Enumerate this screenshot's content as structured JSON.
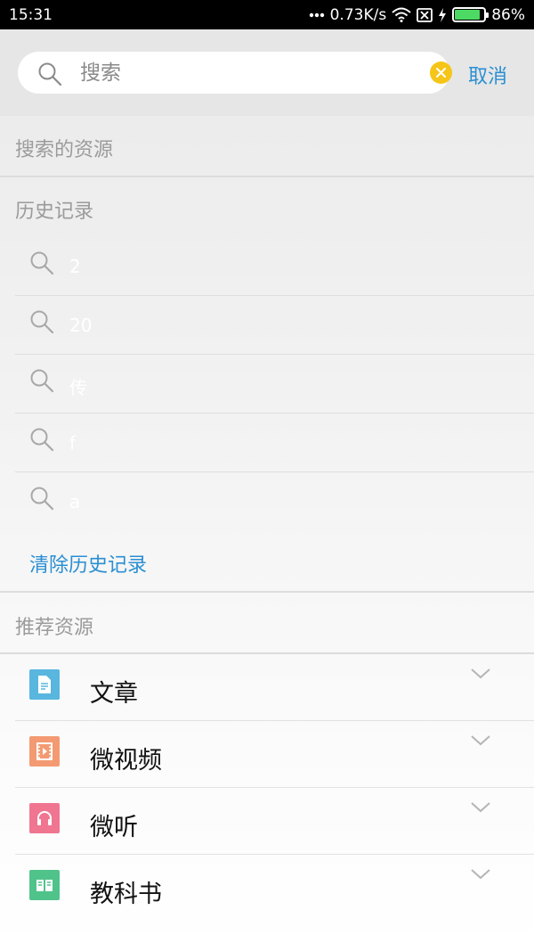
{
  "status_bar": {
    "time": "15:31",
    "net_speed": "0.73K/s",
    "battery": "86%",
    "battery_level": 0.86,
    "icons": [
      "dots-icon",
      "wifi-icon",
      "sim-off-icon",
      "charging-icon",
      "battery-icon"
    ]
  },
  "search": {
    "placeholder": "搜索",
    "value": "",
    "cancel_label": "取消",
    "clear_color": "#f5c518"
  },
  "sections": {
    "searched_resources": "搜索的资源",
    "history": "历史记录",
    "recommended": "推荐资源"
  },
  "history": {
    "items": [
      {
        "text": "2"
      },
      {
        "text": "20"
      },
      {
        "text": "传"
      },
      {
        "text": "f"
      },
      {
        "text": "a"
      }
    ],
    "clear_label": "清除历史记录"
  },
  "recommended": {
    "items": [
      {
        "label": "文章",
        "icon": "document-icon",
        "color": "#58b6df"
      },
      {
        "label": "微视频",
        "icon": "video-icon",
        "color": "#f39a72"
      },
      {
        "label": "微听",
        "icon": "headphones-icon",
        "color": "#f07591"
      },
      {
        "label": "教科书",
        "icon": "book-icon",
        "color": "#4fc38a"
      }
    ]
  },
  "colors": {
    "accent": "#2a8fd2",
    "header_bg": "#e6e6e6",
    "section_text": "#9b9b9b"
  }
}
